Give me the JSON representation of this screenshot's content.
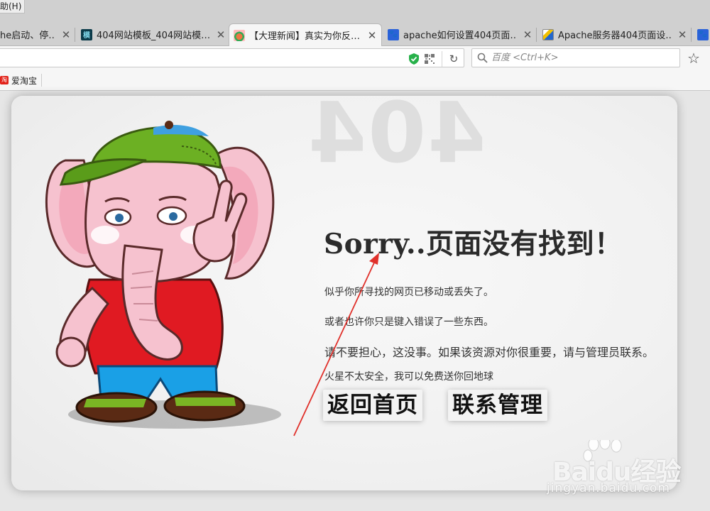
{
  "menu": {
    "help_label": "助(H)"
  },
  "tabs": [
    {
      "title": "he启动、停…",
      "favicon": "none"
    },
    {
      "title": "404网站模板_404网站模…",
      "favicon": "模"
    },
    {
      "title": "【大理新闻】真实为你反…",
      "favicon": "news"
    },
    {
      "title": "apache如何设置404页面…",
      "favicon": "paw"
    },
    {
      "title": "Apache服务器404页面设…",
      "favicon": "doc"
    },
    {
      "title": "",
      "favicon": "paw"
    }
  ],
  "active_tab_index": 2,
  "tab_close_glyph": "✕",
  "toolbar": {
    "address_value": "",
    "search_placeholder": "百度 <Ctrl+K>",
    "reload_glyph": "↻",
    "star_glyph": "☆"
  },
  "bookmarks": [
    {
      "label": "爱淘宝",
      "icon_text": "淘"
    }
  ],
  "page": {
    "bg_number": "404",
    "headline": "Sorry..页面没有找到！",
    "messages": [
      "似乎你所寻找的网页已移动或丢失了。",
      "或者也许你只是键入错误了一些东西。",
      "请不要担心，这没事。如果该资源对你很重要，请与管理员联系。",
      "火星不太安全，我可以免费送你回地球"
    ],
    "buttons": {
      "home": "返回首页",
      "contact": "联系管理"
    }
  },
  "watermark": {
    "logo_text": "Baidu经验",
    "url": "jingyan.baidu.com"
  },
  "colors": {
    "tab_bar": "#d0d0d0",
    "toolbar": "#f6f6f6",
    "card_bg": "#f1f1f1",
    "arrow": "#e0302a",
    "shield": "#27b14a"
  }
}
